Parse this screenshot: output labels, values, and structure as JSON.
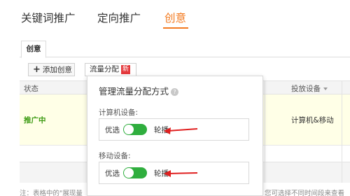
{
  "top_tabs": [
    "关键词推广",
    "定向推广",
    "创意"
  ],
  "inner_tab": "创意",
  "toolbar": {
    "add_label": "添加创意",
    "traffic_label": "流量分配",
    "new_badge": "新"
  },
  "table": {
    "headers": [
      "状态",
      "投放设备"
    ],
    "rows": [
      {
        "status": "推广中",
        "device": "计算机&移动"
      }
    ]
  },
  "footnote_left": "注：表格中的\"展现量",
  "footnote_right": "您可选择不同时间段来查看",
  "popover": {
    "title": "管理流量分配方式",
    "sections": [
      {
        "label": "计算机设备:",
        "left_option": "优选",
        "right_option": "轮播"
      },
      {
        "label": "移动设备:",
        "left_option": "优选",
        "right_option": "轮播"
      }
    ]
  },
  "colors": {
    "accent": "#f37a1f",
    "status_green": "#3f9c16",
    "toggle_green": "#2fae3e",
    "badge_red": "#e4393c",
    "arrow_red": "#e02020"
  }
}
